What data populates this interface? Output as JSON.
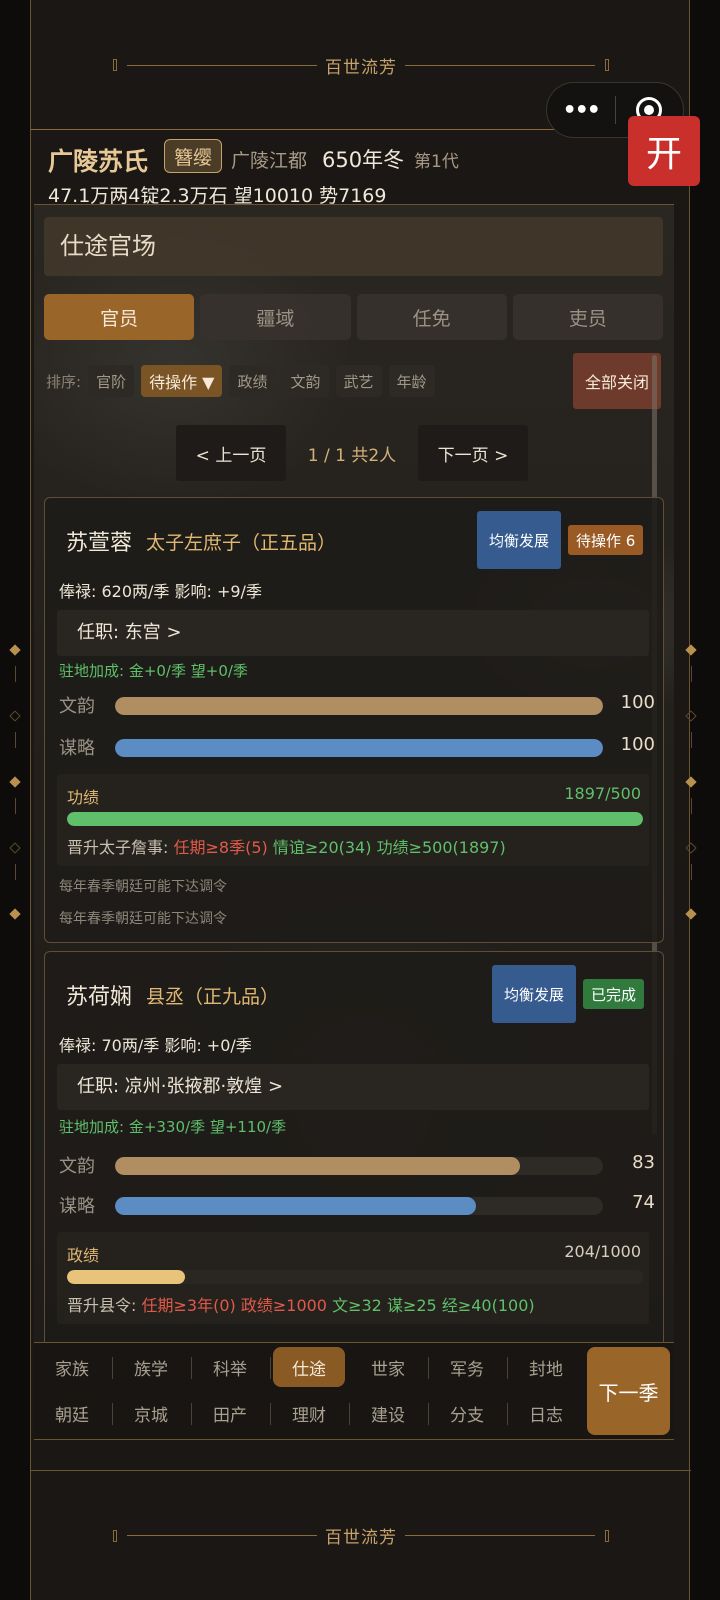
{
  "banner": {
    "text": "百世流芳"
  },
  "capsule": {
    "more_icon": "•••"
  },
  "kai_button": {
    "label": "开"
  },
  "clan": {
    "name": "广陵苏氏",
    "badge": "簪缨",
    "location": "广陵江都",
    "date": "650年冬",
    "generation": "第1代",
    "resources": "47.1万两4锭2.3万石 望10010 势7169"
  },
  "panel": {
    "title": "仕途官场"
  },
  "tabs": [
    {
      "label": "官员",
      "active": true
    },
    {
      "label": "疆域"
    },
    {
      "label": "任免"
    },
    {
      "label": "吏员"
    }
  ],
  "sort": {
    "label": "排序:",
    "options": [
      "官阶",
      "待操作 ▼",
      "政绩",
      "文韵",
      "武艺",
      "年龄"
    ],
    "active": "待操作 ▼",
    "close_all": "全部关闭"
  },
  "pager": {
    "prev": "< 上一页",
    "info": "1 / 1  共2人",
    "next": "下一页 >"
  },
  "officials": [
    {
      "name": "苏萱蓉",
      "title": "太子左庶子（正五品）",
      "strategy": "均衡发展",
      "status": "待操作 6",
      "salary": "俸禄: 620两/季   影响: +9/季",
      "post": "任职: 东宫   >",
      "bonus": "驻地加成: 金+0/季  望+0/季",
      "wen": {
        "label": "文韵",
        "value": 100,
        "max": 100,
        "display": "100"
      },
      "mou": {
        "label": "谋略",
        "value": 100,
        "max": 100,
        "display": "100"
      },
      "merit": {
        "label": "功绩",
        "value": 1897,
        "max": 500,
        "display": "1897/500",
        "color": "#5fbf6a"
      },
      "promo": {
        "head": "晋升太子詹事:",
        "req1": "任期≥8季(5)",
        "req2": "情谊≥20(34)",
        "req3": "功绩≥500(1897)"
      },
      "notes": [
        "每年春季朝廷可能下达调令",
        "每年春季朝廷可能下达调令"
      ]
    },
    {
      "name": "苏荷娴",
      "title": "县丞（正九品）",
      "strategy": "均衡发展",
      "status": "已完成",
      "salary": "俸禄: 70两/季   影响: +0/季",
      "post": "任职: 凉州·张掖郡·敦煌   >",
      "bonus": "驻地加成: 金+330/季  望+110/季",
      "wen": {
        "label": "文韵",
        "value": 83,
        "max": 100,
        "display": "83"
      },
      "mou": {
        "label": "谋略",
        "value": 74,
        "max": 100,
        "display": "74"
      },
      "merit": {
        "label": "政绩",
        "value": 204,
        "max": 1000,
        "display": "204/1000",
        "color": "#e8c47a"
      },
      "promo": {
        "head": "晋升县令:",
        "req1": "任期≥3年(0)",
        "req2": "政绩≥1000",
        "req3": "文≥32",
        "req4": "谋≥25",
        "req5": "经≥40(100)"
      }
    }
  ],
  "nav": {
    "row1": [
      "家族",
      "族学",
      "科举",
      "仕途",
      "世家",
      "军务",
      "封地"
    ],
    "row2": [
      "朝廷",
      "京城",
      "田产",
      "理财",
      "建设",
      "分支",
      "日志"
    ],
    "active": "仕途",
    "next_season": "下一季"
  }
}
